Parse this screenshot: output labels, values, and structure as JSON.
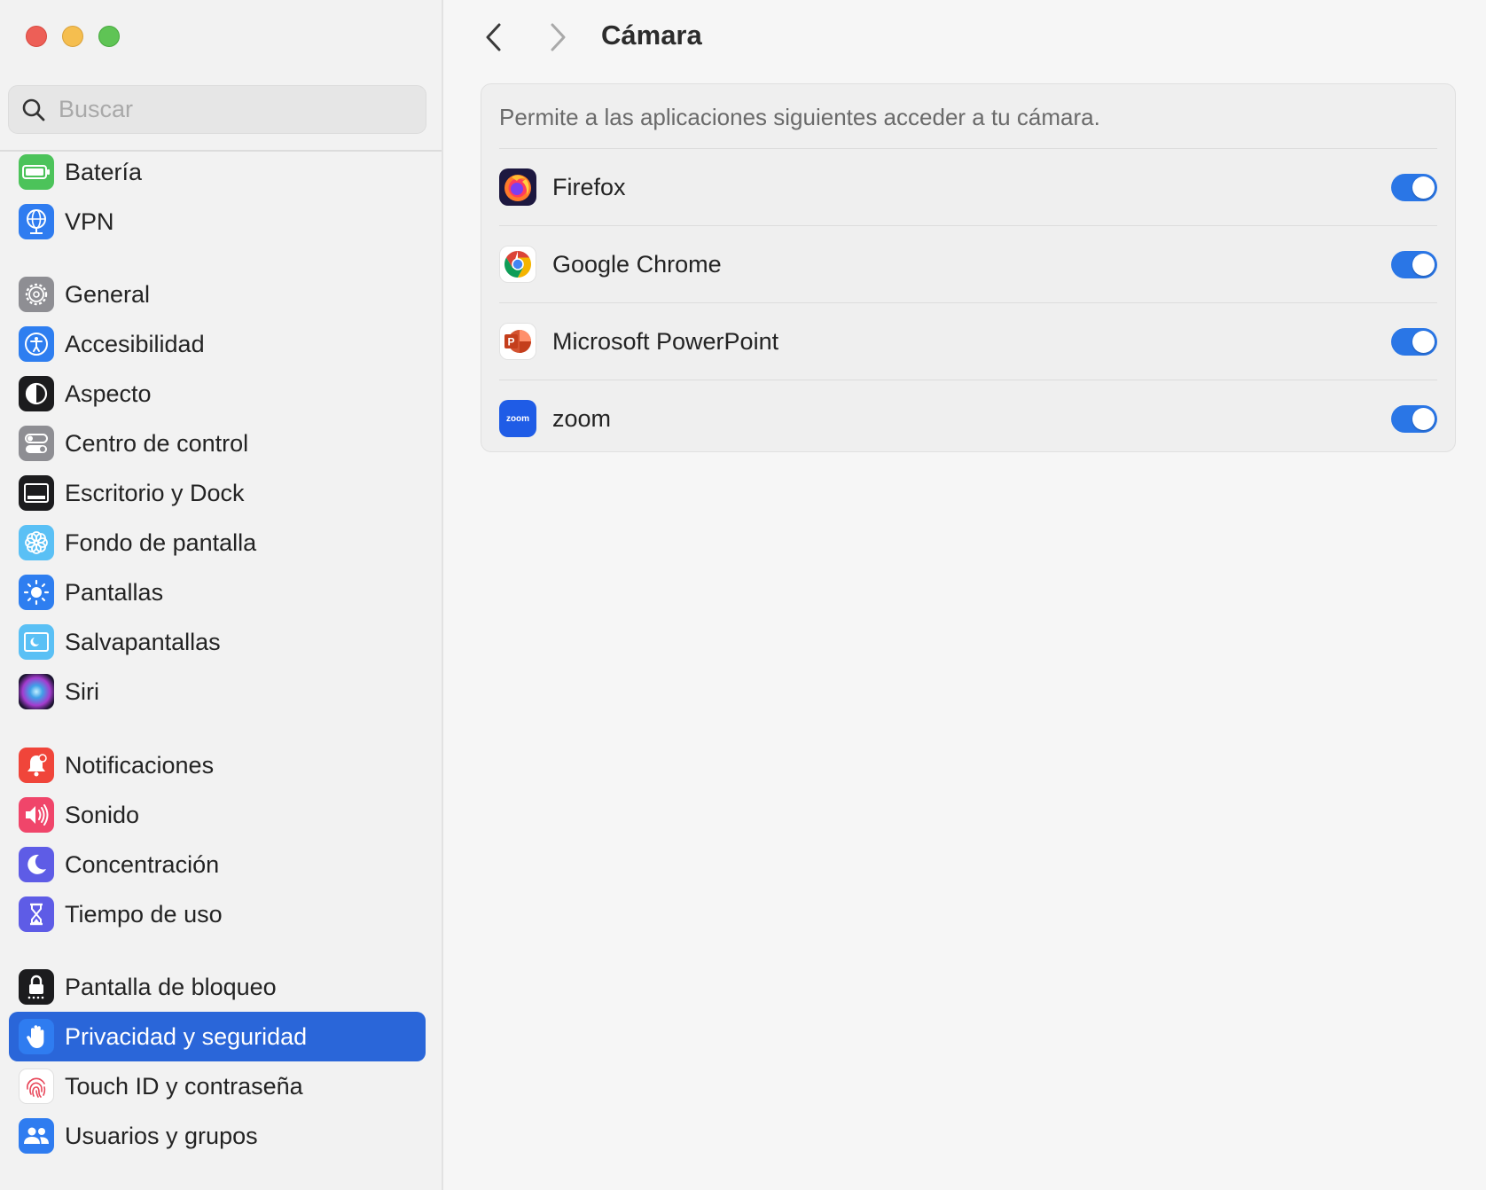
{
  "window": {
    "controls": [
      "close",
      "minimize",
      "maximize"
    ]
  },
  "search": {
    "placeholder": "Buscar",
    "value": ""
  },
  "sidebar": {
    "items": [
      {
        "label": "Batería",
        "icon": "battery-icon",
        "color": "#4cc35a"
      },
      {
        "label": "VPN",
        "icon": "globe-icon",
        "color": "#2f7cf0"
      },
      {
        "label": "General",
        "icon": "gear-icon",
        "color": "#8e8e93"
      },
      {
        "label": "Accesibilidad",
        "icon": "accessibility-icon",
        "color": "#2e7ef0"
      },
      {
        "label": "Aspecto",
        "icon": "appearance-icon",
        "color": "#1c1c1e"
      },
      {
        "label": "Centro de control",
        "icon": "toggles-icon",
        "color": "#8e8e93"
      },
      {
        "label": "Escritorio y Dock",
        "icon": "dock-icon",
        "color": "#1c1c1e"
      },
      {
        "label": "Fondo de pantalla",
        "icon": "flower-icon",
        "color": "#5ac0f5"
      },
      {
        "label": "Pantallas",
        "icon": "sun-icon",
        "color": "#2e7ef0"
      },
      {
        "label": "Salvapantallas",
        "icon": "screensaver-icon",
        "color": "#5ac0f5"
      },
      {
        "label": "Siri",
        "icon": "siri-icon",
        "color": "#3a2a5a"
      },
      {
        "label": "Notificaciones",
        "icon": "bell-icon",
        "color": "#f0453a"
      },
      {
        "label": "Sonido",
        "icon": "speaker-icon",
        "color": "#f0456a"
      },
      {
        "label": "Concentración",
        "icon": "moon-icon",
        "color": "#5e5ce6"
      },
      {
        "label": "Tiempo de uso",
        "icon": "hourglass-icon",
        "color": "#5e5ce6"
      },
      {
        "label": "Pantalla de bloqueo",
        "icon": "lock-icon",
        "color": "#1c1c1e"
      },
      {
        "label": "Privacidad y seguridad",
        "icon": "hand-icon",
        "color": "#2f7cf0",
        "selected": true
      },
      {
        "label": "Touch ID y contraseña",
        "icon": "fingerprint-icon",
        "color": "#ffffff"
      },
      {
        "label": "Usuarios y grupos",
        "icon": "users-icon",
        "color": "#2f7cf0"
      }
    ]
  },
  "header": {
    "title": "Cámara"
  },
  "panel": {
    "description": "Permite a las aplicaciones siguientes acceder a tu cámara.",
    "apps": [
      {
        "name": "Firefox",
        "icon": "firefox-icon",
        "enabled": true
      },
      {
        "name": "Google Chrome",
        "icon": "chrome-icon",
        "enabled": true
      },
      {
        "name": "Microsoft PowerPoint",
        "icon": "powerpoint-icon",
        "enabled": true
      },
      {
        "name": "zoom",
        "icon": "zoom-icon",
        "enabled": true,
        "icon_text": "zoom"
      }
    ]
  },
  "colors": {
    "accent": "#2a66d9",
    "toggle_on": "#2a76e6"
  }
}
